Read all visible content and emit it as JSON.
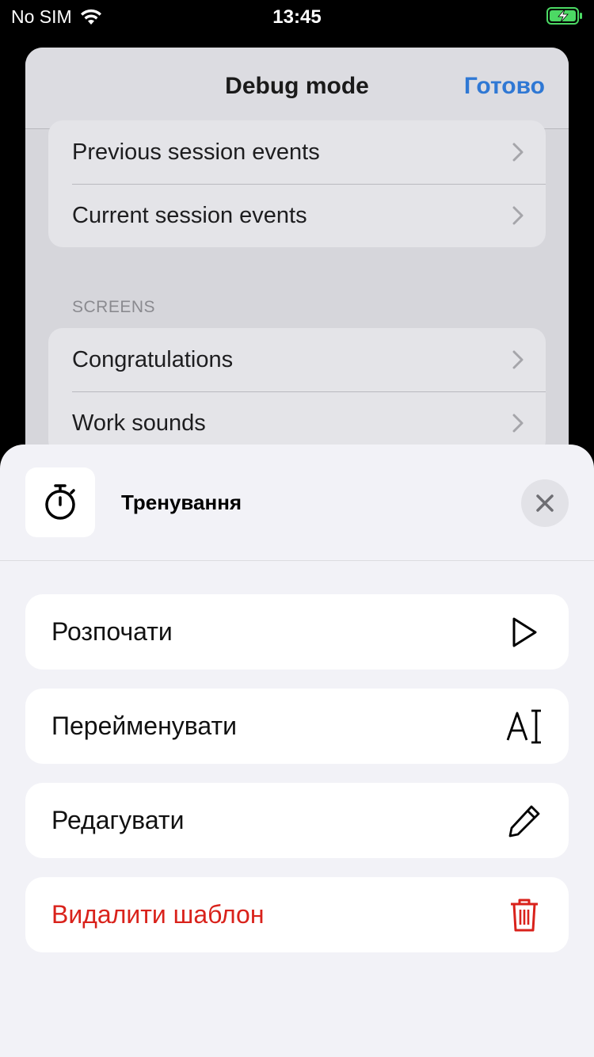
{
  "status_bar": {
    "carrier": "No SIM",
    "time": "13:45",
    "wifi_icon": "wifi-icon",
    "battery_icon": "battery-charging-icon",
    "battery_color": "#4cd964"
  },
  "background_sheet": {
    "title": "Debug mode",
    "done_label": "Готово",
    "events_group": [
      {
        "label": "Previous session events"
      },
      {
        "label": "Current session events"
      }
    ],
    "screens_section_header": "SCREENS",
    "screens_group": [
      {
        "label": "Congratulations"
      },
      {
        "label": "Work sounds"
      }
    ]
  },
  "action_sheet": {
    "icon": "stopwatch-icon",
    "title": "Тренування",
    "close_icon": "close-icon",
    "actions": [
      {
        "label": "Розпочати",
        "icon": "play-icon"
      },
      {
        "label": "Перейменувати",
        "icon": "rename-text-cursor-icon"
      },
      {
        "label": "Редагувати",
        "icon": "pencil-icon"
      },
      {
        "label": "Видалити шаблон",
        "icon": "trash-icon",
        "destructive": true
      }
    ]
  },
  "colors": {
    "accent_blue": "#2f78d4",
    "destructive_red": "#d9221b"
  }
}
